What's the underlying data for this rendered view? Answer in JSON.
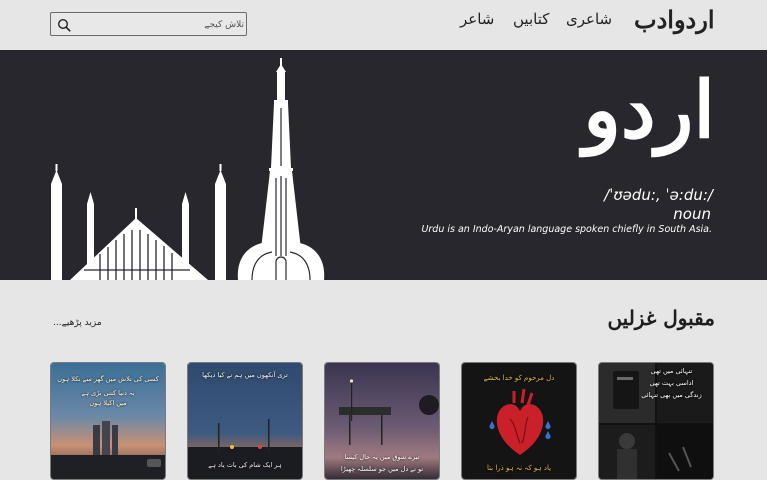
{
  "header": {
    "logo": "اردوادب",
    "nav": [
      "شاعری",
      "کتابیں",
      "شاعر"
    ],
    "search_placeholder": "تلاش کیجے"
  },
  "hero": {
    "word": "اردو",
    "pronunciation": "/ˈʊədu:, ˈə:du:/",
    "part_of_speech": "noun",
    "definition": "Urdu is an Indo-Aryan language spoken chiefly in South Asia."
  },
  "section": {
    "title": "مقبول غزلیں",
    "more_link": "مزید پڑھیے..."
  },
  "cards": [
    {
      "lines": [
        "کسی کی تلاش میں گھر سے نکلا ہوں",
        "یہ دنیا کتنی بڑی ہے",
        "میں اکیلا ہوں"
      ],
      "label": "card-1"
    },
    {
      "lines": [
        "تری آنکھوں میں ہم نے کیا دیکھا",
        "ہر ایک شام کی بات یاد ہے"
      ],
      "label": "card-2"
    },
    {
      "lines": [
        "تیرے شوق میں یہ حال کیسا",
        "تو نے دل میں جو سلسلہ چھیڑا"
      ],
      "label": "card-3"
    },
    {
      "lines": [
        "دل مرحوم کو خدا بخشے",
        "یاد ہو کہ نہ ہو ذرا بتا"
      ],
      "label": "card-4"
    },
    {
      "lines": [
        "تنہائی میں تھی",
        "اداسی بہت تھی",
        "زندگی میں بھی تنہائی"
      ],
      "label": "card-5"
    }
  ],
  "colors": {
    "hero_bg": "#28272d",
    "page_bg": "#e6e6e6",
    "text": "#222222"
  }
}
